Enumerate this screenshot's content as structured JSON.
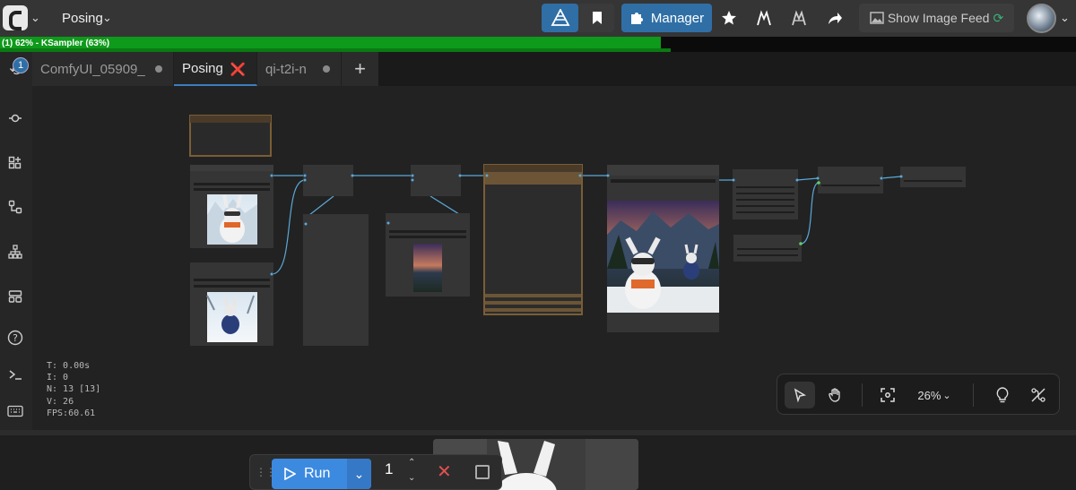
{
  "topbar": {
    "workflow_menu_label": "Posing",
    "manager_label": "Manager",
    "feed_label": "Show Image Feed"
  },
  "progress": {
    "text": "(1) 62% - KSampler (63%)",
    "value_percent": 62
  },
  "sidebar": {
    "queue_badge": "1"
  },
  "tabs": [
    {
      "label": "ComfyUI_05909_"
    },
    {
      "label": "Posing"
    },
    {
      "label": "qi-t2i-n"
    }
  ],
  "stats": {
    "t": "T: 0.00s",
    "i": "I: 0",
    "n": "N: 13 [13]",
    "v": "V: 26",
    "fps": "FPS:60.61"
  },
  "zoom": {
    "level": "26%"
  },
  "runbar": {
    "run_label": "Run",
    "batch_count": "1"
  },
  "colors": {
    "accent": "#2f6fa6",
    "progress": "#0e9a1a",
    "run": "#3c8ae0",
    "group_frame": "#7a5d36"
  }
}
